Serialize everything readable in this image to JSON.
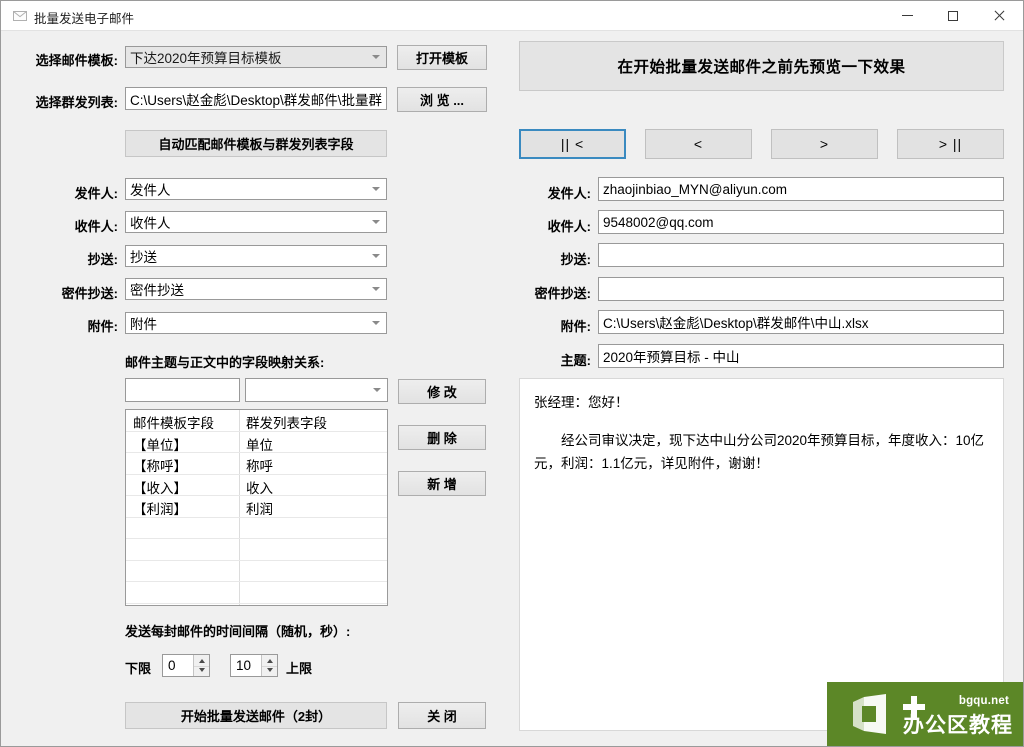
{
  "window": {
    "title": "批量发送电子邮件",
    "icon": "mail-icon",
    "controls": {
      "minimize": "minimize-icon",
      "maximize": "maximize-icon",
      "close": "close-icon"
    }
  },
  "left_panel": {
    "template_row": {
      "label": "选择邮件模板:",
      "value": "下达2020年预算目标模板",
      "button": "打开模板"
    },
    "list_row": {
      "label": "选择群发列表:",
      "value": "C:\\Users\\赵金彪\\Desktop\\群发邮件\\批量群",
      "button": "浏 览 ..."
    },
    "automatch_button": "自动匹配邮件模板与群发列表字段",
    "fields": [
      {
        "label": "发件人:",
        "value": "发件人"
      },
      {
        "label": "收件人:",
        "value": "收件人"
      },
      {
        "label": "抄送:",
        "value": "抄送"
      },
      {
        "label": "密件抄送:",
        "value": "密件抄送"
      },
      {
        "label": "附件:",
        "value": "附件"
      }
    ],
    "mapping": {
      "heading": "邮件主题与正文中的字段映射关系:",
      "edit_input_value": "",
      "edit_combo_value": "",
      "buttons": {
        "modify": "修 改",
        "delete": "删 除",
        "add": "新 增"
      },
      "columns": [
        "邮件模板字段",
        "群发列表字段"
      ],
      "rows": [
        {
          "template_field": "【单位】",
          "list_field": "单位"
        },
        {
          "template_field": "【称呼】",
          "list_field": "称呼"
        },
        {
          "template_field": "【收入】",
          "list_field": "收入"
        },
        {
          "template_field": "【利润】",
          "list_field": "利润"
        }
      ]
    },
    "interval": {
      "heading": "发送每封邮件的时间间隔（随机，秒）:",
      "min_label": "下限",
      "min_value": "0",
      "max_value": "10",
      "max_label": "上限"
    },
    "footer": {
      "send_button": "开始批量发送邮件（2封）",
      "close_button": "关 闭"
    }
  },
  "right_panel": {
    "header_button": "在开始批量发送邮件之前先预览一下效果",
    "nav_buttons": [
      {
        "name": "first",
        "label": "|| <",
        "focused": true
      },
      {
        "name": "previous",
        "label": "<",
        "focused": false
      },
      {
        "name": "next",
        "label": ">",
        "focused": false
      },
      {
        "name": "last",
        "label": "> ||",
        "focused": false
      }
    ],
    "fields": [
      {
        "label": "发件人:",
        "value": "zhaojinbiao_MYN@aliyun.com"
      },
      {
        "label": "收件人:",
        "value": "9548002@qq.com"
      },
      {
        "label": "抄送:",
        "value": ""
      },
      {
        "label": "密件抄送:",
        "value": ""
      },
      {
        "label": "附件:",
        "value": "C:\\Users\\赵金彪\\Desktop\\群发邮件\\中山.xlsx"
      },
      {
        "label": "主题:",
        "value": "2020年预算目标 - 中山"
      }
    ],
    "body": {
      "greeting": "张经理：您好！",
      "paragraph": "经公司审议决定，现下达中山分公司2020年预算目标，年度收入：10亿元，利润：1.1亿元，详见附件，谢谢！"
    }
  },
  "watermark": {
    "domain": "bgqu.net",
    "title": "办公区教程",
    "accent_color": "#5c8727",
    "logo_icon": "office-logo-icon",
    "plus_icon": "plus-icon"
  }
}
